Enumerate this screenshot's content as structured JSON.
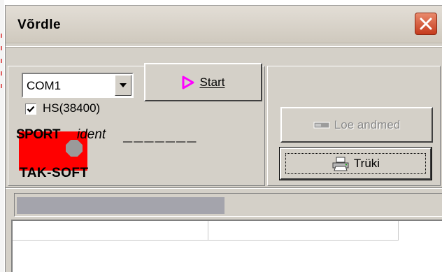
{
  "window": {
    "title": "Võrdle"
  },
  "controls": {
    "port_value": "COM1",
    "start_label": "Start",
    "hs_label": "HS(38400)",
    "hs_checked": true,
    "loe_label": "Loe andmed",
    "loe_enabled": false,
    "truki_label": "Trüki"
  },
  "logo": {
    "sport": "SPORT",
    "ident": "ident",
    "maker": "TAK-SOFT"
  },
  "placeholder_code": "_______",
  "progress": {
    "fraction": 0.49
  },
  "grid": {
    "columns": [
      "",
      "",
      ""
    ]
  },
  "colors": {
    "titlebar": "#e3ded6",
    "face": "#d4d0c8",
    "play_icon": "#ff00ff",
    "logo_red": "#ff0000",
    "close": "#c53b1d",
    "progress_fill": "#a4a4ac"
  },
  "icons": {
    "close": "close-icon",
    "dropdown": "chevron-down-icon",
    "start": "play-icon",
    "loe": "card-reader-icon",
    "truki": "printer-icon",
    "check": "check-icon"
  }
}
